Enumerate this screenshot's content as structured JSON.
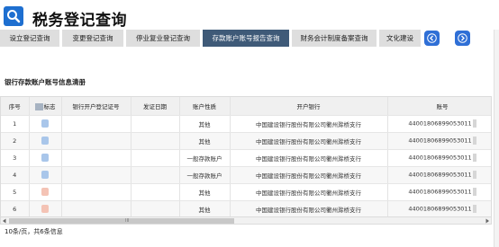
{
  "app": {
    "title": "税务登记查询",
    "search_icon": "search-icon"
  },
  "tabs": [
    {
      "label": "设立登记查询",
      "active": false
    },
    {
      "label": "变更登记查询",
      "active": false
    },
    {
      "label": "停业复业登记查询",
      "active": false
    },
    {
      "label": "存款账户账号报告查询",
      "active": true
    },
    {
      "label": "财务会计制度备案查询",
      "active": false
    },
    {
      "label": "文化建设",
      "active": false
    }
  ],
  "nav": {
    "prev_icon": "chevron-left-icon",
    "next_icon": "chevron-right-icon"
  },
  "section": {
    "title": "银行存款账户账号信息清册"
  },
  "table": {
    "headers": [
      "序号",
      "标志",
      "银行开户登记证号",
      "发证日期",
      "账户性质",
      "开户银行",
      "账号"
    ],
    "rows": [
      {
        "no": "1",
        "nature": "其他",
        "bank": "中国建设银行股份有限公司衢州滁桥支行",
        "account": "44001806899053011"
      },
      {
        "no": "2",
        "nature": "其他",
        "bank": "中国建设银行股份有限公司衢州滁桥支行",
        "account": "44001806899053011"
      },
      {
        "no": "3",
        "nature": "一般存款账户",
        "bank": "中国建设银行股份有限公司衢州滁桥支行",
        "account": "44001806899053011"
      },
      {
        "no": "4",
        "nature": "一般存款账户",
        "bank": "中国建设银行股份有限公司衢州滁桥支行",
        "account": "44001806899053011"
      },
      {
        "no": "5",
        "nature": "其他",
        "bank": "中国建设银行股份有限公司衢州滁桥支行",
        "account": "44001806899053011"
      },
      {
        "no": "6",
        "nature": "其他",
        "bank": "中国建设银行股份有限公司衢州滁桥支行",
        "account": "44001806899053011"
      }
    ]
  },
  "scrollbar": {
    "grip": "III"
  },
  "pager": {
    "text": "10条/页，共6条信息"
  },
  "colors": {
    "active_tab": "#3f5a78",
    "tab": "#dedede",
    "nav_button": "#2f6fd6",
    "badge": "#1e6fd0"
  }
}
